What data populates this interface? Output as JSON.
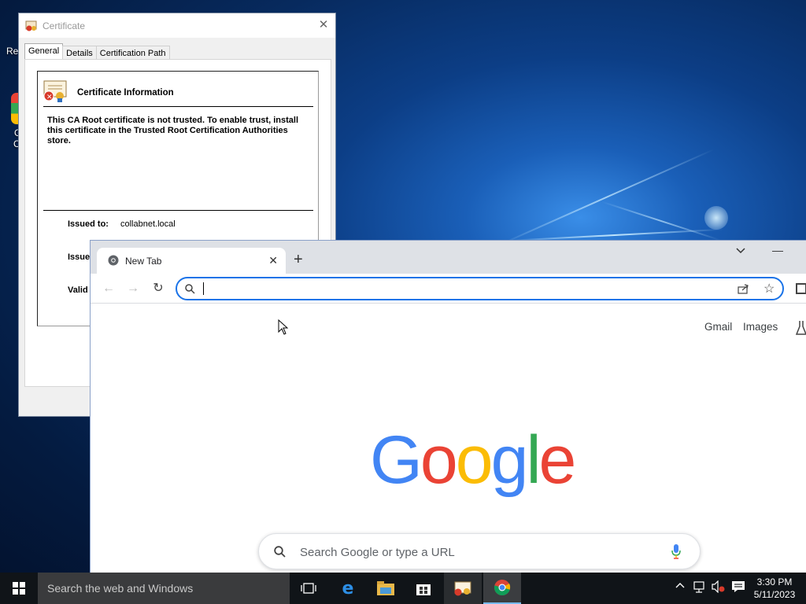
{
  "desktop": {
    "icon_labels": [
      "Re",
      "G",
      "C"
    ]
  },
  "certificate": {
    "title": "Certificate",
    "tabs": [
      "General",
      "Details",
      "Certification Path"
    ],
    "info_title": "Certificate Information",
    "warning": "This CA Root certificate is not trusted. To enable trust, install this certificate in the Trusted Root Certification Authorities store.",
    "issued_to_label": "Issued to:",
    "issued_to_value": "collabnet.local",
    "issued_by_label": "Issue",
    "valid_label": "Valid"
  },
  "chrome": {
    "tab_title": "New Tab",
    "omnibox_value": "",
    "links": [
      "Gmail",
      "Images"
    ],
    "logo": [
      "G",
      "o",
      "o",
      "g",
      "l",
      "e"
    ],
    "logo_colors": [
      "#4285f4",
      "#ea4335",
      "#fbbc05",
      "#4285f4",
      "#34a853",
      "#ea4335"
    ],
    "search_placeholder": "Search Google or type a URL"
  },
  "taskbar": {
    "search_text": "Search the web and Windows",
    "time": "3:30 PM",
    "date": "5/11/2023"
  }
}
